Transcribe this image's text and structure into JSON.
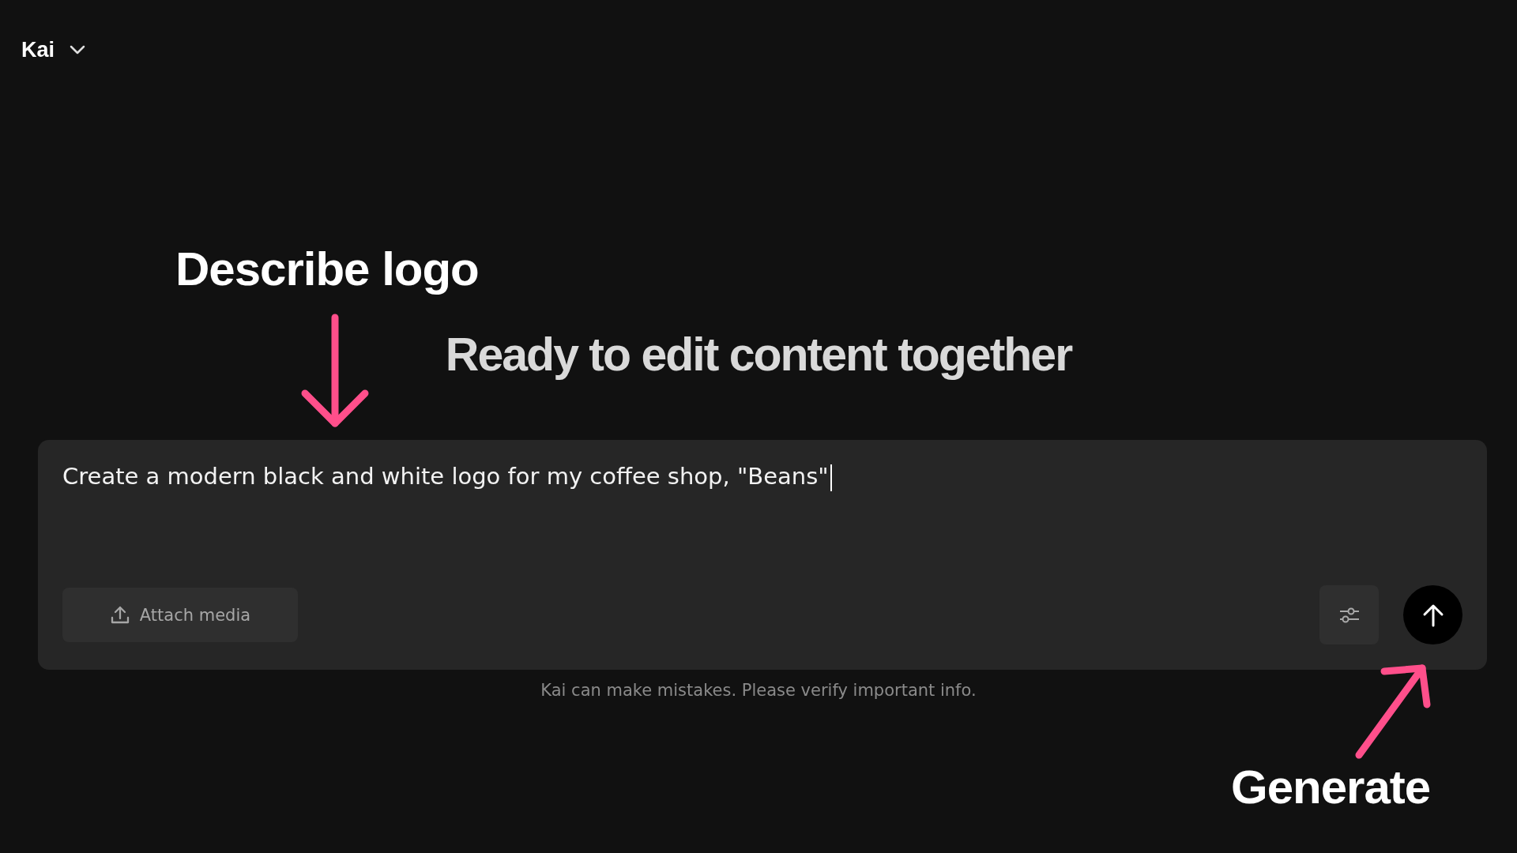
{
  "header": {
    "title": "Kai"
  },
  "heading": "Ready to edit content together",
  "composer": {
    "value": "Create a modern black and white logo for my coffee shop, \"Beans\"",
    "attach_label": "Attach media"
  },
  "disclaimer": "Kai can make mistakes. Please verify important info.",
  "annotations": [
    {
      "text": "Describe logo",
      "kind": "down"
    },
    {
      "text": "Generate",
      "kind": "up-right"
    }
  ]
}
